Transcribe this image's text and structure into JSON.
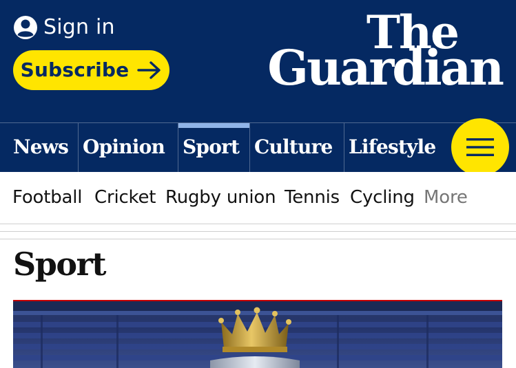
{
  "header": {
    "sign_in_label": "Sign in",
    "subscribe_label": "Subscribe",
    "logo_line1": "The",
    "logo_line2": "Guardian"
  },
  "pillars": [
    {
      "label": "News",
      "active": false
    },
    {
      "label": "Opinion",
      "active": false
    },
    {
      "label": "Sport",
      "active": true
    },
    {
      "label": "Culture",
      "active": false
    },
    {
      "label": "Lifestyle",
      "active": false
    }
  ],
  "subnav": {
    "items": [
      "Football",
      "Cricket",
      "Rugby union",
      "Tennis",
      "Cycling"
    ],
    "more_label": "More"
  },
  "section": {
    "title": "Sport"
  },
  "icons": {
    "account": "user-circle-icon",
    "subscribe_arrow": "arrow-right-icon",
    "menu": "hamburger-menu-icon"
  },
  "colors": {
    "brand_blue": "#052962",
    "brand_yellow": "#ffe500",
    "sport_accent": "#90b4e8",
    "divider": "#506991",
    "text": "#121212",
    "muted": "#767676"
  }
}
